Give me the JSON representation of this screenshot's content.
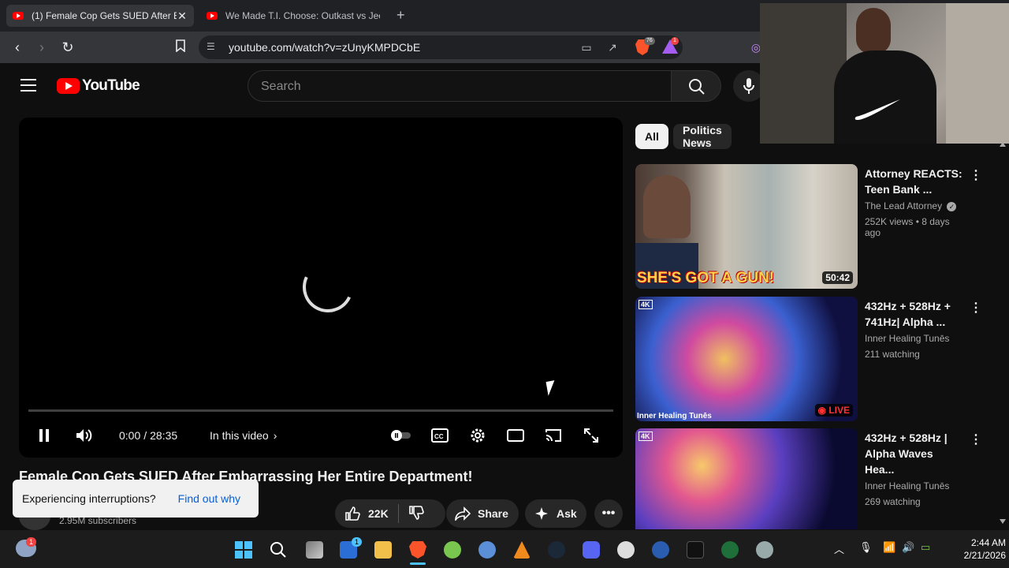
{
  "browser": {
    "tabs": [
      {
        "title": "(1) Female Cop Gets SUED After E",
        "active": true
      },
      {
        "title": "We Made T.I. Choose: Outkast vs Jee",
        "active": false
      }
    ],
    "new_tab_glyph": "+",
    "url": "youtube.com/watch?v=zUnyKMPDCbE",
    "shields_badge": "76",
    "rewards_badge": "1"
  },
  "youtube": {
    "logo_text": "YouTube",
    "search_placeholder": "Search",
    "player": {
      "time_current": "0:00",
      "time_separator": "/",
      "time_total": "28:35",
      "in_this_video": "In this video"
    },
    "video_title": "Female Cop Gets SUED After Embarrassing Her Entire Department!",
    "subscribers": "2.95M subscribers",
    "toast": {
      "message": "Experiencing interruptions?",
      "link": "Find out why"
    },
    "actions": {
      "likes": "22K",
      "share": "Share",
      "ask": "Ask"
    },
    "chips": [
      "All",
      "Politics News"
    ],
    "recommendations": [
      {
        "title": "Attorney REACTS: Teen Bank ...",
        "channel": "The Lead Attorney",
        "verified": true,
        "stats": "252K views",
        "age": "8 days ago",
        "badge": "50:42",
        "thumb_text": "SHE'S GOT A GUN!"
      },
      {
        "title": "432Hz + 528Hz + 741Hz| Alpha ...",
        "channel": "Inner Healing Tunēs",
        "verified": false,
        "stats": "211 watching",
        "age": "",
        "badge": "LIVE",
        "thumb_text": "Inner Healing Tunēs"
      },
      {
        "title": "432Hz + 528Hz | Alpha Waves Hea...",
        "channel": "Inner Healing Tunēs",
        "verified": false,
        "stats": "269 watching",
        "age": "",
        "badge": "",
        "thumb_text": ""
      }
    ]
  },
  "taskbar": {
    "weather_badge": "1",
    "store_badge": "1",
    "time": "2:44 AM",
    "date": "2/21/2026"
  },
  "colors": {
    "accent": "#ff0000",
    "link": "#065fd4",
    "live": "#ff3333"
  }
}
